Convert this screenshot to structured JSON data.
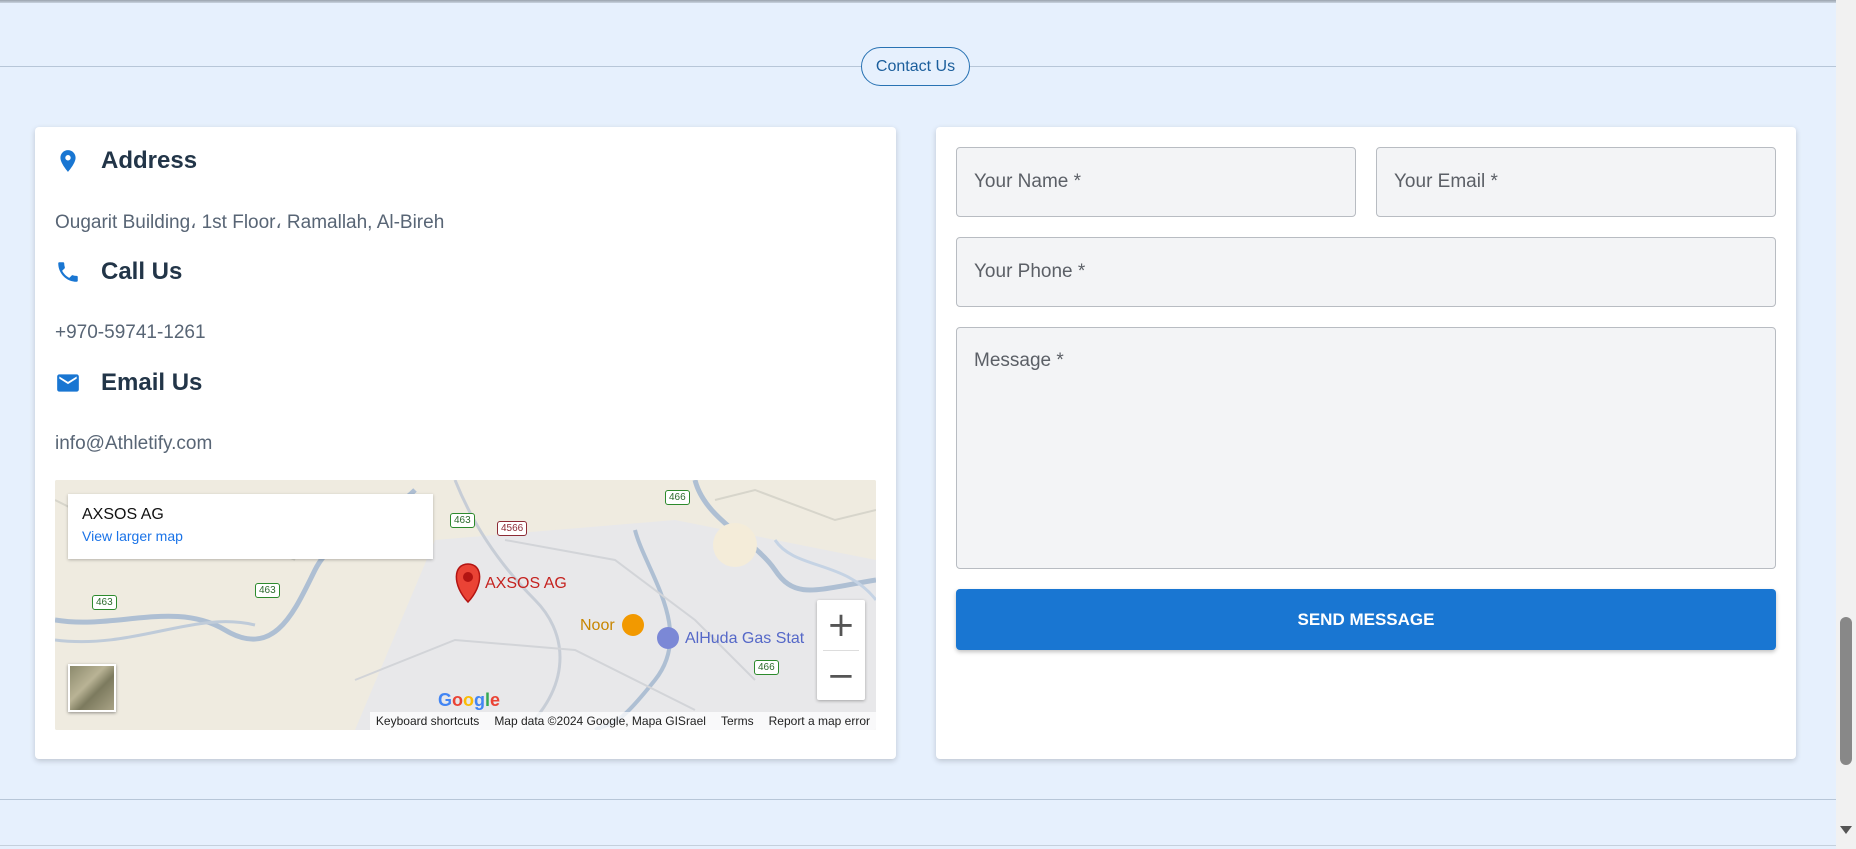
{
  "section": {
    "title": "Contact Us"
  },
  "info": {
    "address": {
      "heading": "Address",
      "text": "Ougarit Building، 1st Floor، Ramallah, Al-Bireh",
      "icon": "location-pin-icon"
    },
    "call": {
      "heading": "Call Us",
      "text": "+970-59741-1261",
      "icon": "phone-icon"
    },
    "email": {
      "heading": "Email Us",
      "text": "info@Athletify.com",
      "icon": "mail-icon"
    }
  },
  "map": {
    "place_name": "AXSOS AG",
    "view_larger": "View larger map",
    "pin_label": "AXSOS AG",
    "poi_noor": "Noor",
    "poi_gas": "AlHuda Gas Stat",
    "roads": [
      "463",
      "4566",
      "466",
      "463",
      "463",
      "466"
    ],
    "google": "Google",
    "footer": {
      "shortcuts": "Keyboard shortcuts",
      "data": "Map data ©2024 Google, Mapa GISrael",
      "terms": "Terms",
      "report": "Report a map error"
    },
    "zoom_in": "+",
    "zoom_out": "−"
  },
  "form": {
    "name_placeholder": "Your Name *",
    "email_placeholder": "Your Email *",
    "phone_placeholder": "Your Phone *",
    "message_placeholder": "Message *",
    "send_label": "SEND MESSAGE"
  },
  "colors": {
    "accent": "#1976d2",
    "background": "#e6f0fd",
    "heading": "#223548"
  }
}
